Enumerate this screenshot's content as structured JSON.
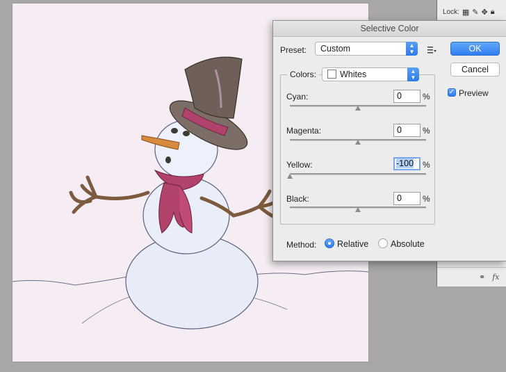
{
  "layers_panel": {
    "lock_label": "Lock:",
    "lock_icons": [
      "lock-transparent-icon",
      "brush-icon",
      "move-icon",
      "lock-all-icon"
    ],
    "bottom_icons": [
      "link-icon",
      "fx-icon"
    ],
    "fx_label": "fx"
  },
  "dialog": {
    "title": "Selective Color",
    "preset_label": "Preset:",
    "preset_value": "Custom",
    "ok_label": "OK",
    "cancel_label": "Cancel",
    "preview_label": "Preview",
    "preview_checked": true,
    "colors_label": "Colors:",
    "colors_value": "Whites",
    "sliders": [
      {
        "label": "Cyan:",
        "value": "0",
        "unit": "%",
        "slider_fraction": 0.5
      },
      {
        "label": "Magenta:",
        "value": "0",
        "unit": "%",
        "slider_fraction": 0.5
      },
      {
        "label": "Yellow:",
        "value": "-100",
        "unit": "%",
        "slider_fraction": 0.0
      },
      {
        "label": "Black:",
        "value": "0",
        "unit": "%",
        "slider_fraction": 0.5
      }
    ],
    "method_label": "Method:",
    "method_options": [
      {
        "label": "Relative",
        "selected": true
      },
      {
        "label": "Absolute",
        "selected": false
      }
    ]
  },
  "colors": {
    "accent": "#2f7cf0",
    "dialog_bg": "#ececec",
    "workspace_bg": "#a7a7a7"
  }
}
